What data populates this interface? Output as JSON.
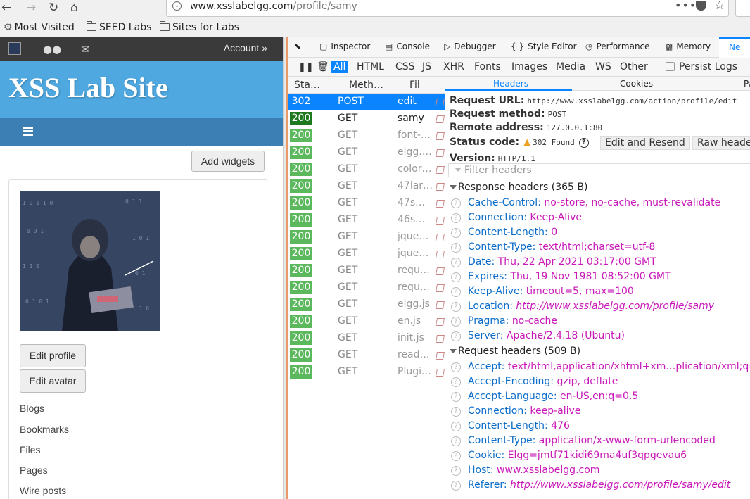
{
  "browser": {
    "url_host": "www.xsslabelgg.com",
    "url_path": "/profile/samy",
    "bookmarks": [
      "Most Visited",
      "SEED Labs",
      "Sites for Labs"
    ]
  },
  "site": {
    "account_label": "Account »",
    "title": "XSS Lab Site",
    "add_widgets_label": "Add widgets",
    "edit_profile_label": "Edit profile",
    "edit_avatar_label": "Edit avatar",
    "links": [
      "Blogs",
      "Bookmarks",
      "Files",
      "Pages",
      "Wire posts"
    ]
  },
  "devtools": {
    "tabs": [
      "Inspector",
      "Console",
      "Debugger",
      "Style Editor",
      "Performance",
      "Memory",
      "Ne"
    ],
    "filters": [
      "All",
      "HTML",
      "CSS",
      "JS",
      "XHR",
      "Fonts",
      "Images",
      "Media",
      "WS",
      "Other"
    ],
    "persist_logs_label": "Persist Logs",
    "columns": [
      "Sta…",
      "Meth…",
      "Fil"
    ],
    "requests": [
      {
        "status": "302",
        "method": "POST",
        "file": "edit"
      },
      {
        "status": "200",
        "method": "GET",
        "file": "samy"
      },
      {
        "status": "200",
        "method": "GET",
        "file": "font-…"
      },
      {
        "status": "200",
        "method": "GET",
        "file": "elgg.…"
      },
      {
        "status": "200",
        "method": "GET",
        "file": "color…"
      },
      {
        "status": "200",
        "method": "GET",
        "file": "47lar…"
      },
      {
        "status": "200",
        "method": "GET",
        "file": "47s…"
      },
      {
        "status": "200",
        "method": "GET",
        "file": "46s…"
      },
      {
        "status": "200",
        "method": "GET",
        "file": "jque…"
      },
      {
        "status": "200",
        "method": "GET",
        "file": "jque…"
      },
      {
        "status": "200",
        "method": "GET",
        "file": "requ…"
      },
      {
        "status": "200",
        "method": "GET",
        "file": "requ…"
      },
      {
        "status": "200",
        "method": "GET",
        "file": "elgg.js"
      },
      {
        "status": "200",
        "method": "GET",
        "file": "en.js"
      },
      {
        "status": "200",
        "method": "GET",
        "file": "init.js"
      },
      {
        "status": "200",
        "method": "GET",
        "file": "read…"
      },
      {
        "status": "200",
        "method": "GET",
        "file": "Plugi…"
      }
    ],
    "detail_tabs": [
      "Headers",
      "Cookies",
      "Pa"
    ],
    "request_url_label": "Request URL:",
    "request_url": "http://www.xsslabelgg.com/action/profile/edit",
    "request_method_label": "Request method:",
    "request_method": "POST",
    "remote_address_label": "Remote address:",
    "remote_address": "127.0.0.1:80",
    "status_code_label": "Status code:",
    "status_code": "302 Found",
    "edit_resend_label": "Edit and Resend",
    "raw_headers_label": "Raw header",
    "version_label": "Version:",
    "version": "HTTP/1.1",
    "filter_headers_placeholder": "Filter headers",
    "response_headers_title": "Response headers (365 B)",
    "response_headers": [
      {
        "key": "Cache-Control:",
        "value": "no-store, no-cache, must-revalidate"
      },
      {
        "key": "Connection:",
        "value": "Keep-Alive"
      },
      {
        "key": "Content-Length:",
        "value": "0"
      },
      {
        "key": "Content-Type:",
        "value": "text/html;charset=utf-8"
      },
      {
        "key": "Date:",
        "value": "Thu, 22 Apr 2021 03:17:00 GMT"
      },
      {
        "key": "Expires:",
        "value": "Thu, 19 Nov 1981 08:52:00 GMT"
      },
      {
        "key": "Keep-Alive:",
        "value": "timeout=5, max=100"
      },
      {
        "key": "Location:",
        "value": "http://www.xsslabelgg.com/profile/samy"
      },
      {
        "key": "Pragma:",
        "value": "no-cache"
      },
      {
        "key": "Server:",
        "value": "Apache/2.4.18 (Ubuntu)"
      }
    ],
    "request_headers_title": "Request headers (509 B)",
    "request_headers": [
      {
        "key": "Accept:",
        "value": "text/html,application/xhtml+xm…plication/xml;q="
      },
      {
        "key": "Accept-Encoding:",
        "value": "gzip, deflate"
      },
      {
        "key": "Accept-Language:",
        "value": "en-US,en;q=0.5"
      },
      {
        "key": "Connection:",
        "value": "keep-alive"
      },
      {
        "key": "Content-Length:",
        "value": "476"
      },
      {
        "key": "Content-Type:",
        "value": "application/x-www-form-urlencoded"
      },
      {
        "key": "Cookie:",
        "value": "Elgg=jmtf71kidi69ma4uf3qpgevau6"
      },
      {
        "key": "Host:",
        "value": "www.xsslabelgg.com"
      },
      {
        "key": "Referer:",
        "value": "http://www.xsslabelgg.com/profile/samy/edit"
      }
    ]
  },
  "colors": {
    "accent": "#0a84ff",
    "status_ok": "#5cb85c",
    "banner": "#4fa8e0",
    "header_value": "#c818b8",
    "header_key": "#0a6cc9"
  }
}
